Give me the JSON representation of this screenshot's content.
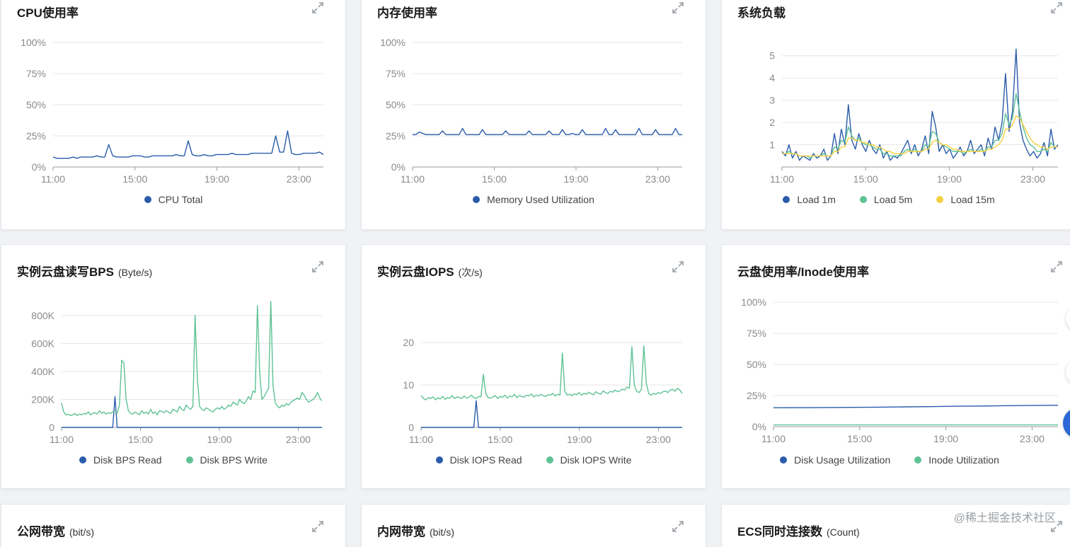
{
  "colors": {
    "blue": "#2a5caa",
    "green": "#5ec295",
    "yellow": "#f4d03f",
    "grid": "#e6e6e6",
    "axis": "#999999",
    "tick": "#8a8a8a"
  },
  "cards": {
    "cpu": {
      "title": "CPU使用率",
      "unit": ""
    },
    "mem": {
      "title": "内存使用率",
      "unit": ""
    },
    "load": {
      "title": "系统负载",
      "unit": ""
    },
    "bps": {
      "title": "实例云盘读写BPS",
      "unit": "(Byte/s)"
    },
    "iops": {
      "title": "实例云盘IOPS",
      "unit": "(次/s)"
    },
    "disk": {
      "title": "云盘使用率/Inode使用率",
      "unit": ""
    },
    "pub": {
      "title": "公网带宽",
      "unit": "(bit/s)"
    },
    "priv": {
      "title": "内网带宽",
      "unit": "(bit/s)"
    },
    "conn": {
      "title": "ECS同时连接数",
      "unit": "(Count)"
    }
  },
  "watermark": "@稀土掘金技术社区",
  "chart_data": [
    {
      "id": "cpu",
      "type": "line",
      "x_ticks": [
        "11:00",
        "15:00",
        "19:00",
        "23:00"
      ],
      "y_ticks": [
        "100%",
        "75%",
        "50%",
        "25%",
        "0%"
      ],
      "ylim": [
        0,
        100
      ],
      "series": [
        {
          "name": "CPU Total",
          "color": "#2a5caa",
          "values": [
            8,
            7,
            7,
            7,
            7,
            8,
            7,
            8,
            8,
            8,
            8,
            9,
            8,
            8,
            18,
            9,
            8,
            8,
            8,
            8,
            9,
            9,
            9,
            8,
            8,
            9,
            9,
            9,
            9,
            9,
            9,
            10,
            9,
            9,
            21,
            10,
            9,
            9,
            10,
            9,
            9,
            10,
            10,
            10,
            10,
            11,
            10,
            10,
            10,
            10,
            11,
            11,
            11,
            11,
            11,
            11,
            25,
            12,
            12,
            29,
            11,
            10,
            10,
            11,
            11,
            11,
            11,
            12,
            10
          ]
        }
      ]
    },
    {
      "id": "mem",
      "type": "line",
      "x_ticks": [
        "11:00",
        "15:00",
        "19:00",
        "23:00"
      ],
      "y_ticks": [
        "100%",
        "75%",
        "50%",
        "25%",
        "0%"
      ],
      "ylim": [
        0,
        100
      ],
      "series": [
        {
          "name": "Memory Used Utilization",
          "color": "#2a5caa",
          "values": [
            26,
            26,
            28,
            27,
            26,
            26,
            26,
            26,
            26,
            29,
            26,
            26,
            26,
            26,
            26,
            31,
            26,
            26,
            26,
            26,
            26,
            30,
            26,
            26,
            26,
            26,
            26,
            26,
            29,
            26,
            26,
            26,
            26,
            26,
            26,
            29,
            26,
            26,
            26,
            26,
            26,
            29,
            26,
            26,
            26,
            30,
            26,
            26,
            27,
            26,
            26,
            30,
            26,
            26,
            26,
            26,
            26,
            26,
            31,
            26,
            26,
            30,
            26,
            26,
            26,
            26,
            26,
            26,
            31,
            26,
            26,
            26,
            26,
            30,
            26,
            26,
            26,
            26,
            26,
            31,
            26,
            26
          ]
        }
      ]
    },
    {
      "id": "load",
      "type": "line",
      "x_ticks": [
        "11:00",
        "15:00",
        "19:00",
        "23:00"
      ],
      "y_ticks": [
        "5",
        "4",
        "3",
        "2",
        "1"
      ],
      "ylim": [
        0,
        5.5
      ],
      "series": [
        {
          "name": "Load 1m",
          "color": "#2a5caa",
          "values": [
            0.7,
            0.5,
            1.0,
            0.4,
            0.7,
            0.3,
            0.5,
            0.4,
            0.3,
            0.6,
            0.4,
            0.5,
            0.8,
            0.3,
            0.5,
            1.5,
            0.6,
            1.7,
            1.0,
            2.8,
            1.2,
            0.8,
            1.5,
            1.0,
            0.7,
            1.2,
            0.8,
            0.6,
            1.0,
            0.4,
            0.7,
            0.3,
            0.5,
            0.4,
            0.6,
            0.9,
            1.2,
            0.6,
            1.0,
            0.5,
            0.8,
            1.4,
            0.6,
            2.5,
            1.8,
            0.7,
            1.0,
            0.6,
            0.8,
            0.4,
            0.6,
            0.9,
            0.5,
            0.7,
            1.2,
            0.6,
            0.8,
            1.0,
            0.5,
            1.3,
            0.8,
            1.8,
            1.2,
            2.0,
            4.2,
            1.6,
            2.5,
            5.3,
            2.0,
            1.2,
            0.8,
            0.5,
            0.7,
            0.4,
            0.6,
            1.1,
            0.5,
            1.7,
            0.8,
            1.0
          ]
        },
        {
          "name": "Load 5m",
          "color": "#5ec295",
          "values": [
            0.6,
            0.6,
            0.7,
            0.6,
            0.6,
            0.5,
            0.5,
            0.5,
            0.4,
            0.5,
            0.5,
            0.5,
            0.6,
            0.5,
            0.5,
            0.9,
            0.8,
            1.2,
            1.1,
            1.8,
            1.4,
            1.2,
            1.3,
            1.1,
            1.0,
            1.0,
            0.9,
            0.8,
            0.8,
            0.6,
            0.6,
            0.5,
            0.5,
            0.5,
            0.5,
            0.7,
            0.8,
            0.7,
            0.8,
            0.7,
            0.7,
            1.0,
            0.9,
            1.6,
            1.5,
            1.1,
            1.0,
            0.9,
            0.8,
            0.7,
            0.7,
            0.7,
            0.6,
            0.7,
            0.8,
            0.7,
            0.7,
            0.8,
            0.7,
            0.9,
            0.9,
            1.2,
            1.2,
            1.5,
            2.4,
            1.9,
            2.2,
            3.3,
            2.5,
            1.8,
            1.3,
            1.0,
            0.9,
            0.7,
            0.7,
            0.8,
            0.7,
            1.1,
            0.9,
            0.9
          ]
        },
        {
          "name": "Load 15m",
          "color": "#f4d03f",
          "values": [
            0.6,
            0.6,
            0.6,
            0.6,
            0.6,
            0.5,
            0.5,
            0.5,
            0.5,
            0.5,
            0.5,
            0.5,
            0.5,
            0.5,
            0.5,
            0.7,
            0.7,
            0.9,
            0.9,
            1.3,
            1.3,
            1.2,
            1.2,
            1.1,
            1.1,
            1.0,
            1.0,
            0.9,
            0.9,
            0.8,
            0.7,
            0.7,
            0.6,
            0.6,
            0.6,
            0.6,
            0.7,
            0.7,
            0.7,
            0.7,
            0.7,
            0.8,
            0.8,
            1.1,
            1.2,
            1.1,
            1.0,
            1.0,
            0.9,
            0.8,
            0.8,
            0.7,
            0.7,
            0.7,
            0.7,
            0.7,
            0.7,
            0.7,
            0.7,
            0.8,
            0.8,
            0.9,
            1.0,
            1.2,
            1.7,
            1.7,
            1.9,
            2.3,
            2.2,
            1.9,
            1.6,
            1.3,
            1.1,
            1.0,
            0.9,
            0.9,
            0.8,
            0.9,
            0.9,
            0.9
          ]
        }
      ]
    },
    {
      "id": "bps",
      "type": "line",
      "x_ticks": [
        "11:00",
        "15:00",
        "19:00",
        "23:00"
      ],
      "y_ticks": [
        "800K",
        "600K",
        "400K",
        "200K",
        "0"
      ],
      "ylim": [
        0,
        900
      ],
      "series": [
        {
          "name": "Disk BPS Read",
          "color": "#2a5caa",
          "values": [
            0,
            0,
            0,
            0,
            0,
            0,
            0,
            0,
            0,
            0,
            0,
            0,
            0,
            0,
            0,
            0,
            0,
            0,
            0,
            0,
            0,
            0,
            0,
            0,
            220,
            0,
            0,
            0,
            0,
            0,
            0,
            0,
            0,
            0,
            0,
            0,
            0,
            0,
            0,
            0,
            0,
            0,
            0,
            0,
            0,
            0,
            0,
            0,
            0,
            0,
            0,
            0,
            0,
            0,
            0,
            0,
            0,
            0,
            0,
            0,
            0,
            0,
            0,
            0,
            0,
            0,
            0,
            0,
            0,
            0,
            0,
            0,
            0,
            0,
            0,
            0,
            0,
            0,
            0,
            0,
            0,
            0,
            0,
            0,
            0,
            0,
            0,
            0,
            0,
            0,
            0,
            0,
            0,
            0,
            0,
            0,
            0,
            0,
            0,
            0,
            0,
            0,
            0,
            0,
            0,
            0,
            0,
            0,
            0,
            0,
            0,
            0,
            0,
            0,
            0,
            0,
            0,
            0
          ]
        },
        {
          "name": "Disk BPS Write",
          "color": "#5ec295",
          "values": [
            175,
            110,
            90,
            95,
            85,
            90,
            100,
            85,
            95,
            90,
            100,
            95,
            110,
            90,
            100,
            105,
            95,
            120,
            100,
            110,
            95,
            105,
            100,
            110,
            120,
            100,
            160,
            480,
            460,
            200,
            120,
            100,
            95,
            110,
            100,
            90,
            120,
            100,
            110,
            95,
            130,
            100,
            110,
            90,
            120,
            115,
            105,
            120,
            110,
            100,
            130,
            120,
            110,
            150,
            130,
            120,
            160,
            140,
            130,
            150,
            800,
            350,
            150,
            130,
            120,
            140,
            130,
            120,
            110,
            130,
            140,
            130,
            150,
            130,
            140,
            160,
            150,
            180,
            170,
            160,
            200,
            180,
            170,
            190,
            220,
            200,
            260,
            250,
            870,
            400,
            200,
            220,
            250,
            280,
            900,
            300,
            180,
            150,
            140,
            160,
            150,
            170,
            160,
            180,
            190,
            200,
            210,
            200,
            250,
            230,
            200,
            180,
            190,
            200,
            220,
            250,
            210,
            190
          ]
        }
      ]
    },
    {
      "id": "iops",
      "type": "line",
      "x_ticks": [
        "11:00",
        "15:00",
        "19:00",
        "23:00"
      ],
      "y_ticks": [
        "20",
        "10",
        "0"
      ],
      "ylim": [
        0,
        20
      ],
      "series": [
        {
          "name": "Disk IOPS Read",
          "color": "#2a5caa",
          "values": [
            0,
            0,
            0,
            0,
            0,
            0,
            0,
            0,
            0,
            0,
            0,
            0,
            0,
            0,
            0,
            0,
            0,
            0,
            0,
            0,
            0,
            0,
            0,
            6.3,
            0,
            0,
            0,
            0,
            0,
            0,
            0,
            0,
            0,
            0,
            0,
            0,
            0,
            0,
            0,
            0,
            0,
            0,
            0,
            0,
            0,
            0,
            0,
            0,
            0,
            0,
            0,
            0,
            0,
            0,
            0,
            0,
            0,
            0,
            0,
            0,
            0,
            0,
            0,
            0,
            0,
            0,
            0,
            0,
            0,
            0,
            0,
            0,
            0,
            0,
            0,
            0,
            0,
            0,
            0,
            0,
            0,
            0,
            0,
            0,
            0,
            0,
            0,
            0,
            0,
            0,
            0,
            0,
            0,
            0,
            0,
            0,
            0,
            0,
            0,
            0,
            0,
            0,
            0,
            0,
            0,
            0,
            0,
            0,
            0,
            0
          ]
        },
        {
          "name": "Disk IOPS Write",
          "color": "#5ec295",
          "values": [
            7.5,
            6.8,
            6.5,
            7.0,
            6.8,
            7.2,
            6.5,
            7.0,
            6.7,
            7.3,
            6.6,
            7.0,
            6.9,
            7.5,
            6.8,
            7.2,
            7.0,
            6.8,
            7.4,
            6.9,
            7.1,
            7.6,
            7.0,
            6.8,
            7.3,
            7.2,
            12.5,
            8.0,
            7.0,
            6.9,
            7.2,
            7.5,
            6.8,
            7.3,
            7.1,
            7.6,
            6.9,
            7.4,
            7.2,
            7.8,
            7.0,
            7.5,
            7.3,
            7.1,
            7.6,
            7.4,
            7.9,
            7.2,
            7.6,
            7.4,
            7.8,
            7.5,
            7.3,
            7.7,
            7.6,
            8.0,
            7.4,
            7.8,
            7.6,
            17.5,
            8.5,
            7.6,
            7.8,
            7.5,
            7.9,
            7.7,
            8.2,
            7.6,
            8.0,
            7.8,
            8.3,
            7.9,
            7.7,
            8.4,
            8.0,
            7.8,
            8.6,
            8.2,
            8.0,
            8.5,
            8.3,
            8.8,
            8.4,
            8.6,
            9.0,
            8.8,
            9.5,
            9.2,
            19.0,
            10.0,
            8.5,
            8.2,
            9.0,
            19.2,
            10.5,
            8.0,
            7.6,
            8.0,
            7.8,
            8.2,
            8.0,
            8.4,
            8.6,
            8.2,
            8.8,
            9.0,
            8.5,
            9.2,
            8.8,
            8.0
          ]
        }
      ]
    },
    {
      "id": "disk",
      "type": "line",
      "x_ticks": [
        "11:00",
        "15:00",
        "19:00",
        "23:00"
      ],
      "y_ticks": [
        "100%",
        "75%",
        "50%",
        "25%",
        "0%"
      ],
      "ylim": [
        0,
        100
      ],
      "series": [
        {
          "name": "Disk Usage Utilization",
          "color": "#2a5caa",
          "values": [
            15.2,
            15.3,
            15.4,
            15.5,
            15.7,
            15.9,
            16.1,
            16.4,
            16.6,
            16.9,
            17.1,
            17.2
          ]
        },
        {
          "name": "Inode Utilization",
          "color": "#5ec295",
          "values": [
            1.5,
            1.5,
            1.5,
            1.5,
            1.5,
            1.5,
            1.5,
            1.5,
            1.5,
            1.5,
            1.5,
            1.5
          ]
        }
      ]
    }
  ]
}
